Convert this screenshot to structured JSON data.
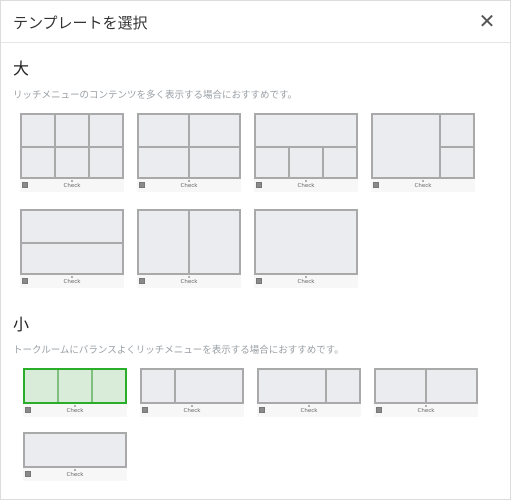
{
  "dialog": {
    "title": "テンプレートを選択",
    "close_icon": "close-icon",
    "close_glyph": "✕"
  },
  "large": {
    "title": "大",
    "description": "リッチメニューのコンテンツを多く表示する場合におすすめです。",
    "templates": [
      {
        "name": "large-6-grid",
        "check_label": "Check",
        "selected": false
      },
      {
        "name": "large-1-top-2-bottom",
        "check_label": "Check",
        "selected": false
      },
      {
        "name": "large-1-top-3-bottom",
        "check_label": "Check",
        "selected": false
      },
      {
        "name": "large-left-big-right-2",
        "check_label": "Check",
        "selected": false
      },
      {
        "name": "large-2-rows",
        "check_label": "Check",
        "selected": false
      },
      {
        "name": "large-2-columns",
        "check_label": "Check",
        "selected": false
      },
      {
        "name": "large-single",
        "check_label": "Check",
        "selected": false
      }
    ]
  },
  "small": {
    "title": "小",
    "description": "トークルームにバランスよくリッチメニューを表示する場合におすすめです。",
    "templates": [
      {
        "name": "small-3-columns",
        "check_label": "Check",
        "selected": true
      },
      {
        "name": "small-narrow-wide",
        "check_label": "Check",
        "selected": false
      },
      {
        "name": "small-wide-narrow",
        "check_label": "Check",
        "selected": false
      },
      {
        "name": "small-2-columns",
        "check_label": "Check",
        "selected": false
      },
      {
        "name": "small-single",
        "check_label": "Check",
        "selected": false
      }
    ]
  },
  "colors": {
    "selected_border": "#2aae2a",
    "tile_fill": "#ebecef",
    "tile_border": "#a9a9a9"
  }
}
